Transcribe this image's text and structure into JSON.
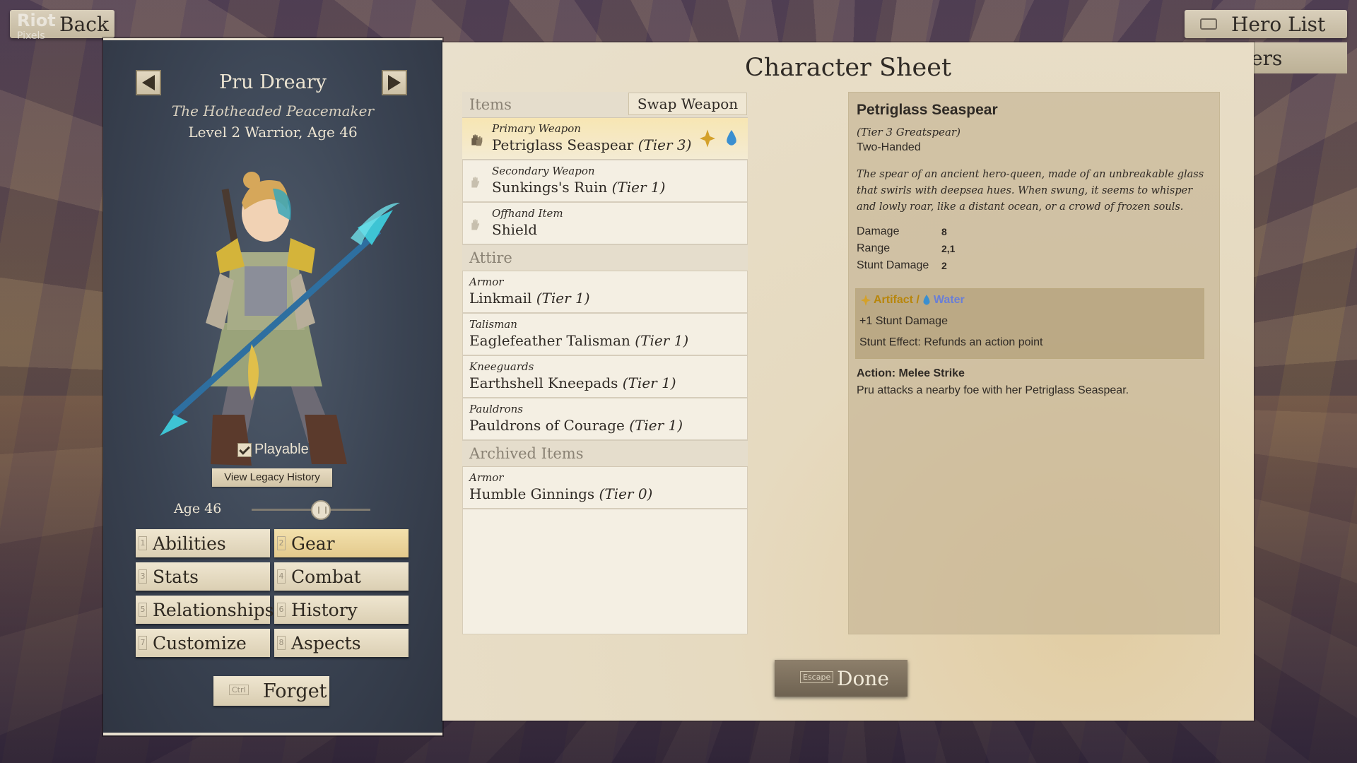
{
  "nav": {
    "back_label": "Back",
    "hero_list_label": "Hero List",
    "partial_button_label": "ers",
    "watermark_top": "Riot",
    "watermark_bottom": "Pixels"
  },
  "character": {
    "name": "Pru Dreary",
    "title": "The Hotheaded Peacemaker",
    "level_line": "Level 2 Warrior, Age 46",
    "playable_label": "Playable",
    "playable_checked": true,
    "legacy_button": "View Legacy History",
    "age_label": "Age 46",
    "age_value": 46
  },
  "tabs": [
    {
      "key": "1",
      "label": "Abilities",
      "active": false
    },
    {
      "key": "2",
      "label": "Gear",
      "active": true
    },
    {
      "key": "3",
      "label": "Stats",
      "active": false
    },
    {
      "key": "4",
      "label": "Combat",
      "active": false
    },
    {
      "key": "5",
      "label": "Relationships",
      "active": false
    },
    {
      "key": "6",
      "label": "History",
      "active": false
    },
    {
      "key": "7",
      "label": "Customize",
      "active": false
    },
    {
      "key": "8",
      "label": "Aspects",
      "active": false
    }
  ],
  "forget": {
    "key": "Ctrl",
    "label": "Forget"
  },
  "sheet": {
    "title": "Character Sheet",
    "items_header": "Items",
    "swap_weapon": "Swap Weapon",
    "items": [
      {
        "category": "Primary Weapon",
        "name": "Petriglass Seaspear",
        "tier": "(Tier 3)"
      },
      {
        "category": "Secondary Weapon",
        "name": "Sunkings's Ruin",
        "tier": "(Tier 1)"
      },
      {
        "category": "Offhand Item",
        "name": "Shield",
        "tier": ""
      }
    ],
    "attire_header": "Attire",
    "attire": [
      {
        "category": "Armor",
        "name": "Linkmail",
        "tier": "(Tier 1)"
      },
      {
        "category": "Talisman",
        "name": "Eaglefeather Talisman",
        "tier": "(Tier 1)"
      },
      {
        "category": "Kneeguards",
        "name": "Earthshell Kneepads",
        "tier": "(Tier 1)"
      },
      {
        "category": "Pauldrons",
        "name": "Pauldrons of Courage",
        "tier": "(Tier 1)"
      }
    ],
    "archived_header": "Archived Items",
    "archived": [
      {
        "category": "Armor",
        "name": "Humble Ginnings",
        "tier": "(Tier 0)"
      }
    ]
  },
  "details": {
    "name": "Petriglass Seaspear",
    "subtitle": "(Tier 3 Greatspear)",
    "handedness": "Two-Handed",
    "description": "The spear of an ancient hero-queen, made of an unbreakable glass that swirls with deepsea hues. When swung, it seems to whisper and lowly roar, like a distant ocean, or a crowd of frozen souls.",
    "stats": [
      {
        "label": "Damage",
        "value": "8"
      },
      {
        "label": "Range",
        "value": "2,1"
      },
      {
        "label": "Stunt Damage",
        "value": "2"
      }
    ],
    "trait_artifact": "Artifact /",
    "trait_water": "Water",
    "trait_line1": "+1 Stunt Damage",
    "trait_line2": "Stunt Effect: Refunds an action point",
    "action_title": "Action: Melee Strike",
    "action_desc": "Pru attacks a nearby foe with her Petriglass Seaspear."
  },
  "done": {
    "key": "Escape",
    "label": "Done"
  },
  "colors": {
    "artifact": "#b8860b",
    "water": "#6a7fd6",
    "active_tab": "#f3e1ad",
    "left_panel": "#3a4352"
  }
}
